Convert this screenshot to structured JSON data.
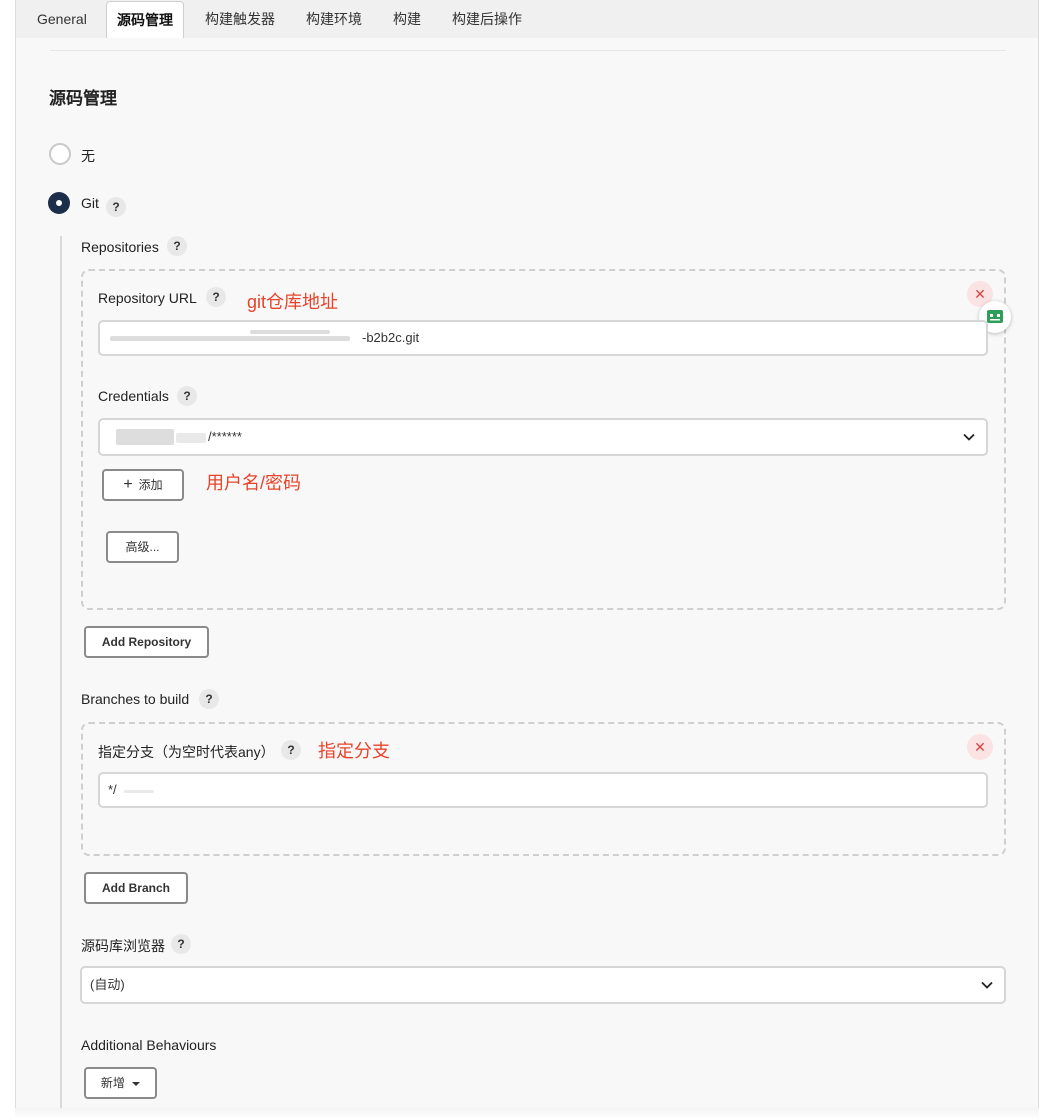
{
  "tabs": [
    {
      "label": "General"
    },
    {
      "label": "源码管理"
    },
    {
      "label": "构建触发器"
    },
    {
      "label": "构建环境"
    },
    {
      "label": "构建"
    },
    {
      "label": "构建后操作"
    }
  ],
  "section_title": "源码管理",
  "scm_options": {
    "none_label": "无",
    "git_label": "Git",
    "selected": "Git"
  },
  "help_symbol": "?",
  "repositories": {
    "label": "Repositories",
    "url_label": "Repository URL",
    "url_annotation": "git仓库地址",
    "url_value_visible": "-b2b2c.git",
    "credentials_label": "Credentials",
    "credentials_value_visible": "/******",
    "credentials_annotation": "用户名/密码",
    "add_button": "添加",
    "advanced_button": "高级...",
    "add_repository_button": "Add Repository"
  },
  "branches": {
    "label": "Branches to build",
    "spec_label": "指定分支（为空时代表any）",
    "spec_annotation": "指定分支",
    "spec_value_visible": "*/",
    "add_branch_button": "Add Branch"
  },
  "browser": {
    "label": "源码库浏览器",
    "value": "(自动)"
  },
  "additional": {
    "label": "Additional Behaviours",
    "add_button": "新增"
  },
  "icons": {
    "close": "close-icon",
    "plus": "plus-icon",
    "chevron": "chevron-down-icon",
    "caret": "caret-down-icon",
    "robot": "robot-icon"
  },
  "colors": {
    "annotation": "#e8432a",
    "radio_checked": "#1c2e4a",
    "close_bg": "#fbe3e3",
    "close_fg": "#d64545"
  }
}
